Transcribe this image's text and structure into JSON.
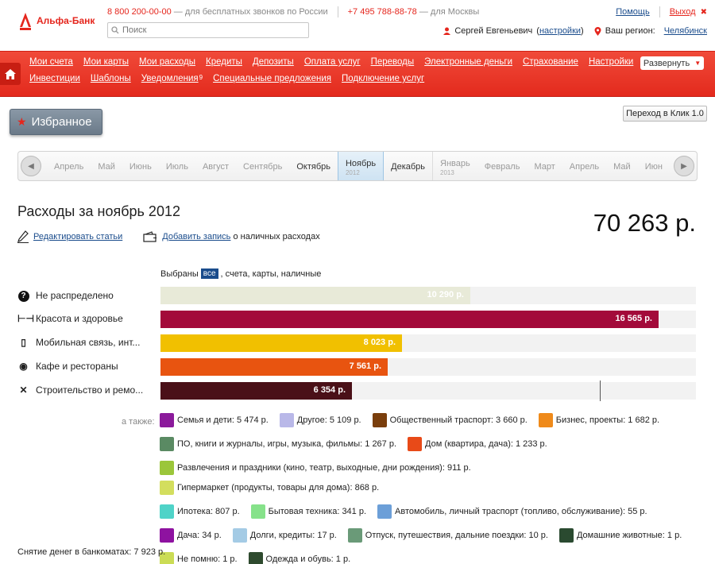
{
  "header": {
    "logo_text": "Альфа-Банк",
    "phone1": "8 800 200-00-00",
    "phone1_note": "— для бесплатных звонков по России",
    "phone2": "+7 495 788-88-78",
    "phone2_note": "— для Москвы",
    "search_placeholder": "Поиск",
    "help": "Помощь",
    "logout": "Выход",
    "user_name": "Сергей Евгеньевич",
    "settings_link": "настройки",
    "region_label": "Ваш регион:",
    "region": "Челябинск"
  },
  "nav": {
    "row1": [
      "Мои счета",
      "Мои карты",
      "Мои расходы",
      "Кредиты",
      "Депозиты",
      "Оплата услуг",
      "Переводы",
      "Электронные деньги",
      "Страхование",
      "Настройки"
    ],
    "row2": [
      "Инвестиции",
      "Шаблоны",
      "Уведомления",
      "Специальные предложения",
      "Подключение услуг"
    ],
    "notif_count": "9",
    "expand": "Развернуть"
  },
  "favorites": "Избранное",
  "klik_button": "Переход в Клик 1.0",
  "months": [
    {
      "name": "Апрель",
      "year": ""
    },
    {
      "name": "Май",
      "year": ""
    },
    {
      "name": "Июнь",
      "year": ""
    },
    {
      "name": "Июль",
      "year": ""
    },
    {
      "name": "Август",
      "year": ""
    },
    {
      "name": "Сентябрь",
      "year": ""
    },
    {
      "name": "Октябрь",
      "year": ""
    },
    {
      "name": "Ноябрь",
      "year": "2012"
    },
    {
      "name": "Декабрь",
      "year": ""
    },
    {
      "name": "Январь",
      "year": "2013"
    },
    {
      "name": "Февраль",
      "year": ""
    },
    {
      "name": "Март",
      "year": ""
    },
    {
      "name": "Апрель",
      "year": ""
    },
    {
      "name": "Май",
      "year": ""
    },
    {
      "name": "Июн",
      "year": ""
    }
  ],
  "title": "Расходы за ноябрь 2012",
  "total": "70 263 р.",
  "actions": {
    "edit": "Редактировать статьи",
    "add": "Добавить запись",
    "add_suffix": "о наличных расходах"
  },
  "filter": {
    "prefix": "Выбраны",
    "badge": "все",
    "suffix": ", счета, карты, наличные"
  },
  "categories": [
    {
      "label": "Не распределено",
      "icon": "question-icon",
      "glyph": "?",
      "value": 10290,
      "value_label": "10 290 р.",
      "color": "#e8ead8"
    },
    {
      "label": "Красота и здоровье",
      "icon": "dumbbell-icon",
      "glyph": "⊢⊣",
      "value": 16565,
      "value_label": "16 565 р.",
      "color": "#a30a3a"
    },
    {
      "label": "Мобильная связь, инт...",
      "icon": "phone-icon",
      "glyph": "▯",
      "value": 8023,
      "value_label": "8 023 р.",
      "color": "#f1c000"
    },
    {
      "label": "Кафе и рестораны",
      "icon": "dish-icon",
      "glyph": "◉",
      "value": 7561,
      "value_label": "7 561 р.",
      "color": "#e85410"
    },
    {
      "label": "Строительство и ремо...",
      "icon": "tools-icon",
      "glyph": "✕",
      "value": 6354,
      "value_label": "6 354 р.",
      "color": "#4a1018"
    }
  ],
  "bar_max": 17800,
  "also_label": "а также:",
  "legend": [
    {
      "label": "Семья и дети: 5 474 р.",
      "color": "#8b1a9b"
    },
    {
      "label": "Другое: 5 109 р.",
      "color": "#b9b8e8"
    },
    {
      "label": "Общественный траспорт: 3 660 р.",
      "color": "#7a3e0c"
    },
    {
      "label": "Бизнес, проекты: 1 682 р.",
      "color": "#ef8a1a"
    },
    {
      "label": "ПО, книги и журналы, игры, музыка, фильмы: 1 267 р.",
      "color": "#5a8a63"
    },
    {
      "label": "Дом (квартира, дача): 1 233 р.",
      "color": "#e84a18"
    },
    {
      "label": "Развлечения и праздники (кино, театр, выходные, дни рождения): 911 р.",
      "color": "#9bc63a"
    },
    {
      "label": "Гипермаркет (продукты, товары для дома): 868 р.",
      "color": "#d3de5e"
    },
    {
      "label": "Ипотека: 807 р.",
      "color": "#4fd3c8"
    },
    {
      "label": "Бытовая техника: 341 р.",
      "color": "#86e28a"
    },
    {
      "label": "Автомобиль, личный траспорт (топливо, обслуживание): 55 р.",
      "color": "#6c9fd8"
    },
    {
      "label": "Дача: 34 р.",
      "color": "#8e12a0"
    },
    {
      "label": "Долги, кредиты: 17 р.",
      "color": "#a4cbe5"
    },
    {
      "label": "Отпуск, путешествия, дальние поездки: 10 р.",
      "color": "#6a9a78"
    },
    {
      "label": "Домашние животные: 1 р.",
      "color": "#2a4a30"
    },
    {
      "label": "Не помню: 1 р.",
      "color": "#cbdc55"
    },
    {
      "label": "Одежда и обувь: 1 р.",
      "color": "#2e4a2e"
    }
  ],
  "atm": "Снятие денег в банкоматах: 7 923 р."
}
